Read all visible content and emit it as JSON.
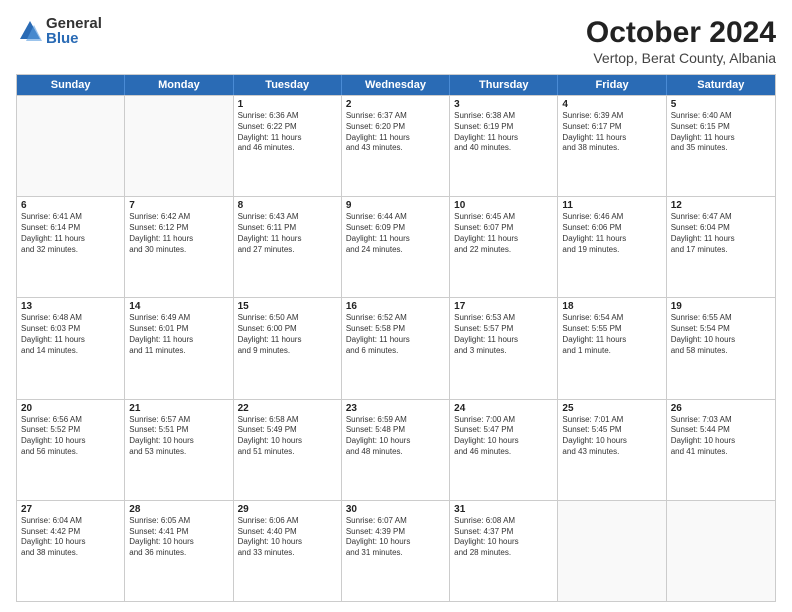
{
  "logo": {
    "general": "General",
    "blue": "Blue"
  },
  "title": "October 2024",
  "location": "Vertop, Berat County, Albania",
  "weekdays": [
    "Sunday",
    "Monday",
    "Tuesday",
    "Wednesday",
    "Thursday",
    "Friday",
    "Saturday"
  ],
  "weeks": [
    [
      {
        "day": "",
        "lines": []
      },
      {
        "day": "",
        "lines": []
      },
      {
        "day": "1",
        "lines": [
          "Sunrise: 6:36 AM",
          "Sunset: 6:22 PM",
          "Daylight: 11 hours",
          "and 46 minutes."
        ]
      },
      {
        "day": "2",
        "lines": [
          "Sunrise: 6:37 AM",
          "Sunset: 6:20 PM",
          "Daylight: 11 hours",
          "and 43 minutes."
        ]
      },
      {
        "day": "3",
        "lines": [
          "Sunrise: 6:38 AM",
          "Sunset: 6:19 PM",
          "Daylight: 11 hours",
          "and 40 minutes."
        ]
      },
      {
        "day": "4",
        "lines": [
          "Sunrise: 6:39 AM",
          "Sunset: 6:17 PM",
          "Daylight: 11 hours",
          "and 38 minutes."
        ]
      },
      {
        "day": "5",
        "lines": [
          "Sunrise: 6:40 AM",
          "Sunset: 6:15 PM",
          "Daylight: 11 hours",
          "and 35 minutes."
        ]
      }
    ],
    [
      {
        "day": "6",
        "lines": [
          "Sunrise: 6:41 AM",
          "Sunset: 6:14 PM",
          "Daylight: 11 hours",
          "and 32 minutes."
        ]
      },
      {
        "day": "7",
        "lines": [
          "Sunrise: 6:42 AM",
          "Sunset: 6:12 PM",
          "Daylight: 11 hours",
          "and 30 minutes."
        ]
      },
      {
        "day": "8",
        "lines": [
          "Sunrise: 6:43 AM",
          "Sunset: 6:11 PM",
          "Daylight: 11 hours",
          "and 27 minutes."
        ]
      },
      {
        "day": "9",
        "lines": [
          "Sunrise: 6:44 AM",
          "Sunset: 6:09 PM",
          "Daylight: 11 hours",
          "and 24 minutes."
        ]
      },
      {
        "day": "10",
        "lines": [
          "Sunrise: 6:45 AM",
          "Sunset: 6:07 PM",
          "Daylight: 11 hours",
          "and 22 minutes."
        ]
      },
      {
        "day": "11",
        "lines": [
          "Sunrise: 6:46 AM",
          "Sunset: 6:06 PM",
          "Daylight: 11 hours",
          "and 19 minutes."
        ]
      },
      {
        "day": "12",
        "lines": [
          "Sunrise: 6:47 AM",
          "Sunset: 6:04 PM",
          "Daylight: 11 hours",
          "and 17 minutes."
        ]
      }
    ],
    [
      {
        "day": "13",
        "lines": [
          "Sunrise: 6:48 AM",
          "Sunset: 6:03 PM",
          "Daylight: 11 hours",
          "and 14 minutes."
        ]
      },
      {
        "day": "14",
        "lines": [
          "Sunrise: 6:49 AM",
          "Sunset: 6:01 PM",
          "Daylight: 11 hours",
          "and 11 minutes."
        ]
      },
      {
        "day": "15",
        "lines": [
          "Sunrise: 6:50 AM",
          "Sunset: 6:00 PM",
          "Daylight: 11 hours",
          "and 9 minutes."
        ]
      },
      {
        "day": "16",
        "lines": [
          "Sunrise: 6:52 AM",
          "Sunset: 5:58 PM",
          "Daylight: 11 hours",
          "and 6 minutes."
        ]
      },
      {
        "day": "17",
        "lines": [
          "Sunrise: 6:53 AM",
          "Sunset: 5:57 PM",
          "Daylight: 11 hours",
          "and 3 minutes."
        ]
      },
      {
        "day": "18",
        "lines": [
          "Sunrise: 6:54 AM",
          "Sunset: 5:55 PM",
          "Daylight: 11 hours",
          "and 1 minute."
        ]
      },
      {
        "day": "19",
        "lines": [
          "Sunrise: 6:55 AM",
          "Sunset: 5:54 PM",
          "Daylight: 10 hours",
          "and 58 minutes."
        ]
      }
    ],
    [
      {
        "day": "20",
        "lines": [
          "Sunrise: 6:56 AM",
          "Sunset: 5:52 PM",
          "Daylight: 10 hours",
          "and 56 minutes."
        ]
      },
      {
        "day": "21",
        "lines": [
          "Sunrise: 6:57 AM",
          "Sunset: 5:51 PM",
          "Daylight: 10 hours",
          "and 53 minutes."
        ]
      },
      {
        "day": "22",
        "lines": [
          "Sunrise: 6:58 AM",
          "Sunset: 5:49 PM",
          "Daylight: 10 hours",
          "and 51 minutes."
        ]
      },
      {
        "day": "23",
        "lines": [
          "Sunrise: 6:59 AM",
          "Sunset: 5:48 PM",
          "Daylight: 10 hours",
          "and 48 minutes."
        ]
      },
      {
        "day": "24",
        "lines": [
          "Sunrise: 7:00 AM",
          "Sunset: 5:47 PM",
          "Daylight: 10 hours",
          "and 46 minutes."
        ]
      },
      {
        "day": "25",
        "lines": [
          "Sunrise: 7:01 AM",
          "Sunset: 5:45 PM",
          "Daylight: 10 hours",
          "and 43 minutes."
        ]
      },
      {
        "day": "26",
        "lines": [
          "Sunrise: 7:03 AM",
          "Sunset: 5:44 PM",
          "Daylight: 10 hours",
          "and 41 minutes."
        ]
      }
    ],
    [
      {
        "day": "27",
        "lines": [
          "Sunrise: 6:04 AM",
          "Sunset: 4:42 PM",
          "Daylight: 10 hours",
          "and 38 minutes."
        ]
      },
      {
        "day": "28",
        "lines": [
          "Sunrise: 6:05 AM",
          "Sunset: 4:41 PM",
          "Daylight: 10 hours",
          "and 36 minutes."
        ]
      },
      {
        "day": "29",
        "lines": [
          "Sunrise: 6:06 AM",
          "Sunset: 4:40 PM",
          "Daylight: 10 hours",
          "and 33 minutes."
        ]
      },
      {
        "day": "30",
        "lines": [
          "Sunrise: 6:07 AM",
          "Sunset: 4:39 PM",
          "Daylight: 10 hours",
          "and 31 minutes."
        ]
      },
      {
        "day": "31",
        "lines": [
          "Sunrise: 6:08 AM",
          "Sunset: 4:37 PM",
          "Daylight: 10 hours",
          "and 28 minutes."
        ]
      },
      {
        "day": "",
        "lines": []
      },
      {
        "day": "",
        "lines": []
      }
    ]
  ]
}
